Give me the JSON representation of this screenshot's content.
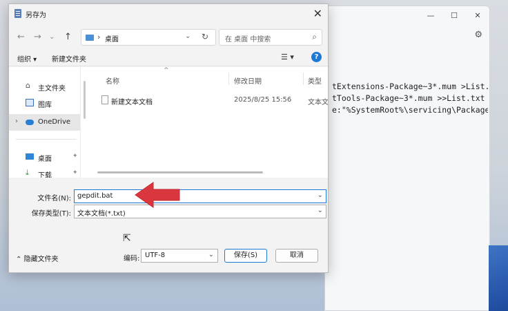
{
  "background_window": {
    "code_lines": [
      "tExtensions-Package~3*.mum >List.txt",
      "tTools-Package~3*.mum >>List.txt",
      "e:\"%SystemRoot%\\servicing\\Packages"
    ]
  },
  "dialog": {
    "title": "另存为",
    "address_path": "桌面",
    "search_placeholder": "在 桌面 中搜索",
    "toolbar": {
      "organize": "组织 ▾",
      "new_folder": "新建文件夹",
      "help": "?"
    },
    "nav_items": [
      {
        "label": "主文件夹"
      },
      {
        "label": "图库"
      },
      {
        "label": "OneDrive"
      },
      {
        "label": "桌面"
      },
      {
        "label": "下载"
      }
    ],
    "columns": {
      "name": "名称",
      "date": "修改日期",
      "type": "类型"
    },
    "files": [
      {
        "name": "新建文本文档",
        "date": "2025/8/25 15:56",
        "type": "文本文档"
      }
    ],
    "filename_label": "文件名(N):",
    "filename_value": "gepdit.bat",
    "filetype_label": "保存类型(T):",
    "filetype_value": "文本文档(*.txt)",
    "hide_folders": "隐藏文件夹",
    "encoding_label": "编码:",
    "encoding_value": "UTF-8",
    "save_label": "保存(S)",
    "cancel_label": "取消"
  },
  "colors": {
    "accent": "#1e78d6",
    "annotation_arrow": "#d9363e"
  }
}
